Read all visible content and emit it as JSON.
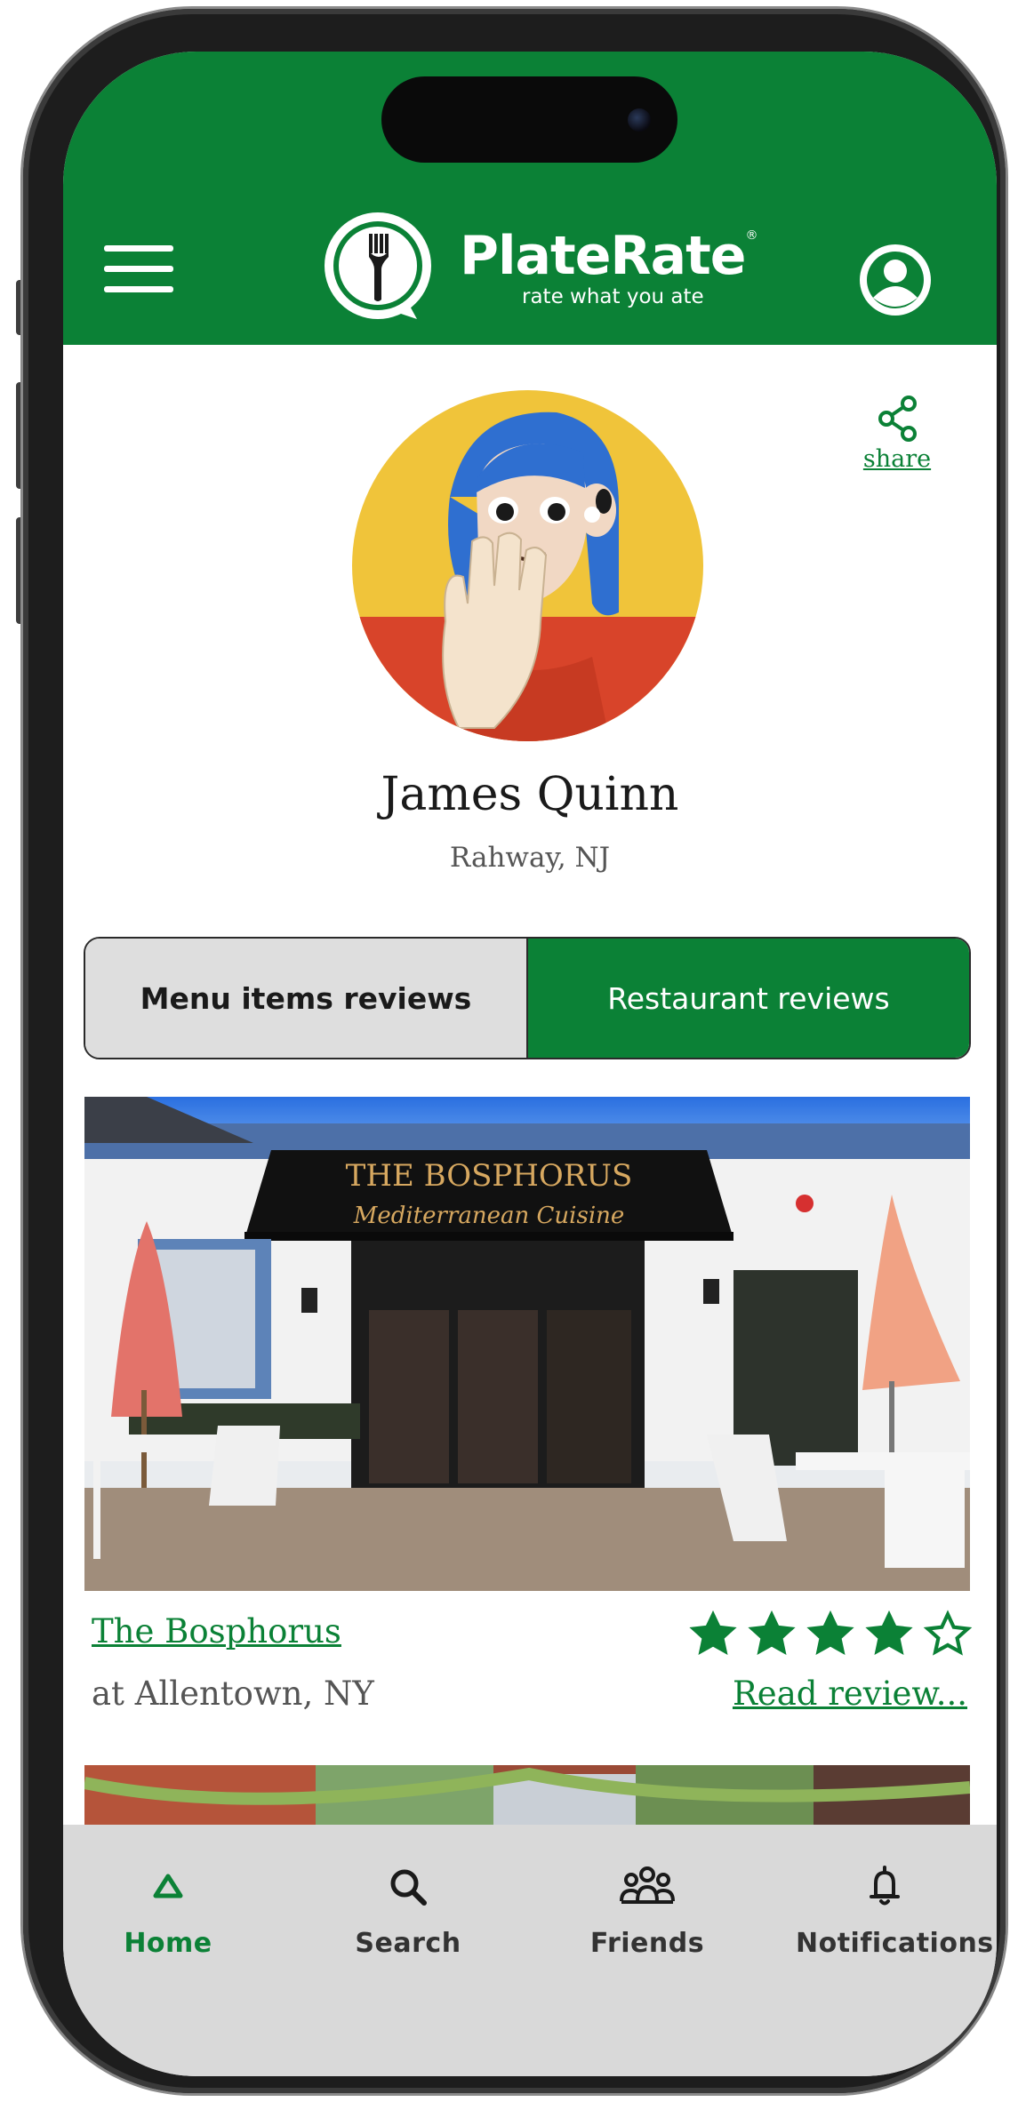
{
  "colors": {
    "brand_green": "#0b8136",
    "nav_bg": "#d9d9d9",
    "tab_inactive_bg": "#dedede"
  },
  "header": {
    "brand_name": "PlateRate",
    "brand_mark": "®",
    "tagline": "rate what you ate",
    "icons": {
      "menu": "hamburger-icon",
      "logo": "fork-plate-icon",
      "profile": "user-circle-icon"
    }
  },
  "profile": {
    "share_label": "share",
    "name": "James Quinn",
    "location": "Rahway, NJ"
  },
  "tabs": [
    {
      "label": "Menu items reviews",
      "selected": false
    },
    {
      "label": "Restaurant reviews",
      "selected": true
    }
  ],
  "reviews": [
    {
      "restaurant": "The Bosphorus",
      "location": "at Allentown, NY",
      "rating": 4,
      "max_rating": 5,
      "read_more": "Read review...",
      "sign_text": {
        "line1": "THE BOSPHORUS",
        "line2": "Mediterranean Cuisine"
      }
    }
  ],
  "bottom_nav": [
    {
      "label": "Home",
      "icon": "home-triangle-icon",
      "active": true
    },
    {
      "label": "Search",
      "icon": "search-icon",
      "active": false
    },
    {
      "label": "Friends",
      "icon": "friends-icon",
      "active": false
    },
    {
      "label": "Notifications",
      "icon": "bell-icon",
      "active": false
    }
  ]
}
